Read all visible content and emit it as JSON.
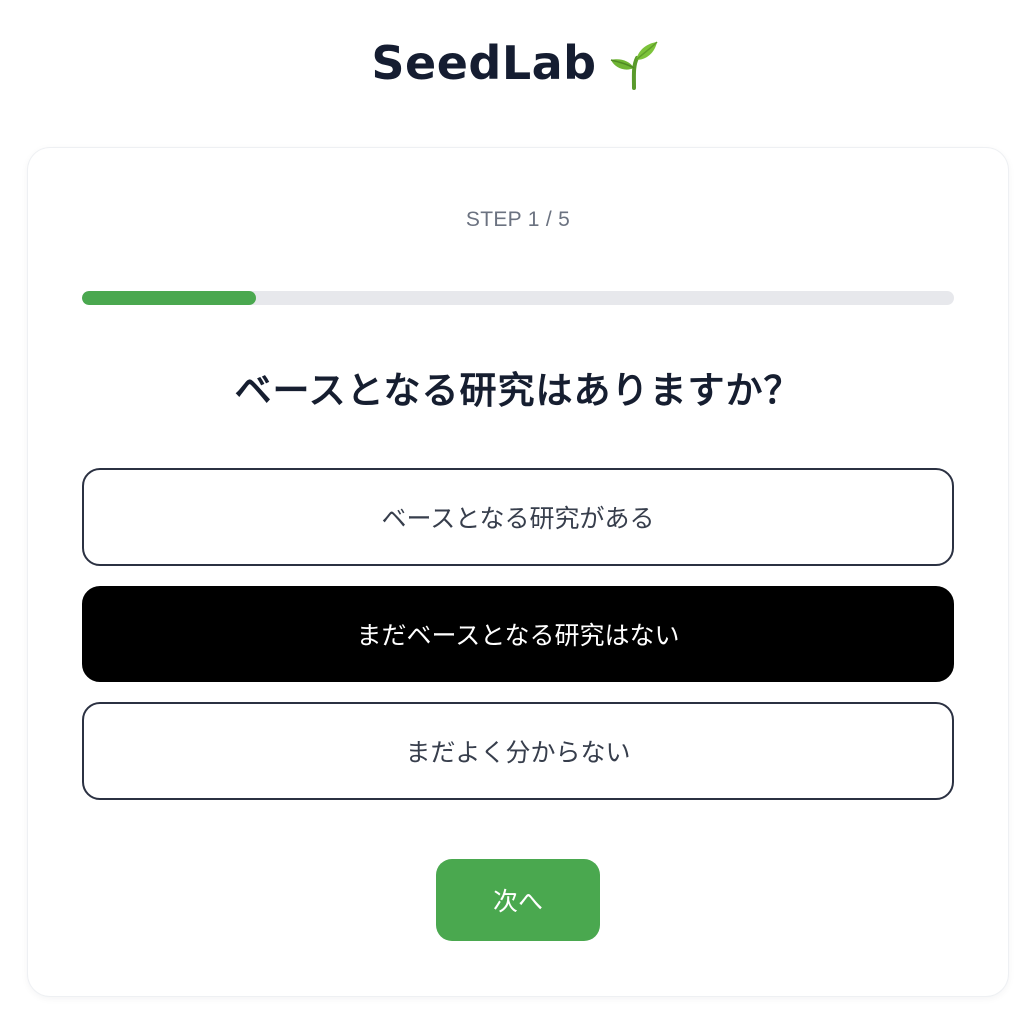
{
  "brand": {
    "name": "SeedLab",
    "icon": "sprout-icon"
  },
  "step": {
    "label": "STEP 1 / 5",
    "current": 1,
    "total": 5,
    "progress_fraction": 0.2
  },
  "question": "ベースとなる研究はありますか？",
  "options": [
    {
      "label": "ベースとなる研究がある",
      "selected": false
    },
    {
      "label": "まだベースとなる研究はない",
      "selected": true
    },
    {
      "label": "まだよく分からない",
      "selected": false
    }
  ],
  "next_button": {
    "label": "次へ"
  },
  "colors": {
    "accent": "#4aa84f",
    "selected_bg": "#000000",
    "track": "#e7e8ec",
    "text_dark": "#161e30"
  }
}
